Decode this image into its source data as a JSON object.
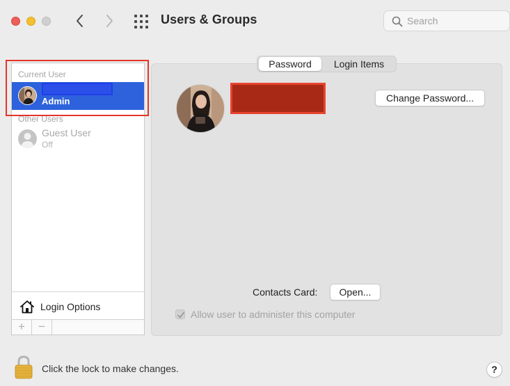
{
  "window": {
    "title": "Users & Groups"
  },
  "search": {
    "placeholder": "Search"
  },
  "sidebar": {
    "current_user_label": "Current User",
    "current_user": {
      "role": "Admin"
    },
    "other_users_label": "Other Users",
    "guest_user": {
      "name": "Guest User",
      "status": "Off"
    },
    "login_options_label": "Login Options",
    "add_label": "+",
    "remove_label": "−"
  },
  "tabs": [
    {
      "label": "Password",
      "selected": true
    },
    {
      "label": "Login Items",
      "selected": false
    }
  ],
  "main": {
    "change_password_label": "Change Password...",
    "contacts_card_label": "Contacts Card:",
    "open_label": "Open...",
    "allow_admin_label": "Allow user to administer this computer",
    "allow_admin_checked": true
  },
  "footer": {
    "lock_text": "Click the lock to make changes.",
    "help_label": "?"
  },
  "colors": {
    "selection": "#2e62dc",
    "highlight_red": "#e3352b",
    "redaction_red": "#a92917",
    "redaction_blue": "#2b50ea",
    "window_bg": "#ececec"
  },
  "icons": {
    "traffic_lights": [
      "close-icon",
      "minimize-icon",
      "zoom-icon"
    ],
    "back": "chevron-left-icon",
    "forward": "chevron-right-icon",
    "show_all": "grid-icon",
    "search": "magnifier-icon",
    "login_options": "house-icon",
    "lock": "padlock-icon",
    "guest": "person-icon"
  }
}
